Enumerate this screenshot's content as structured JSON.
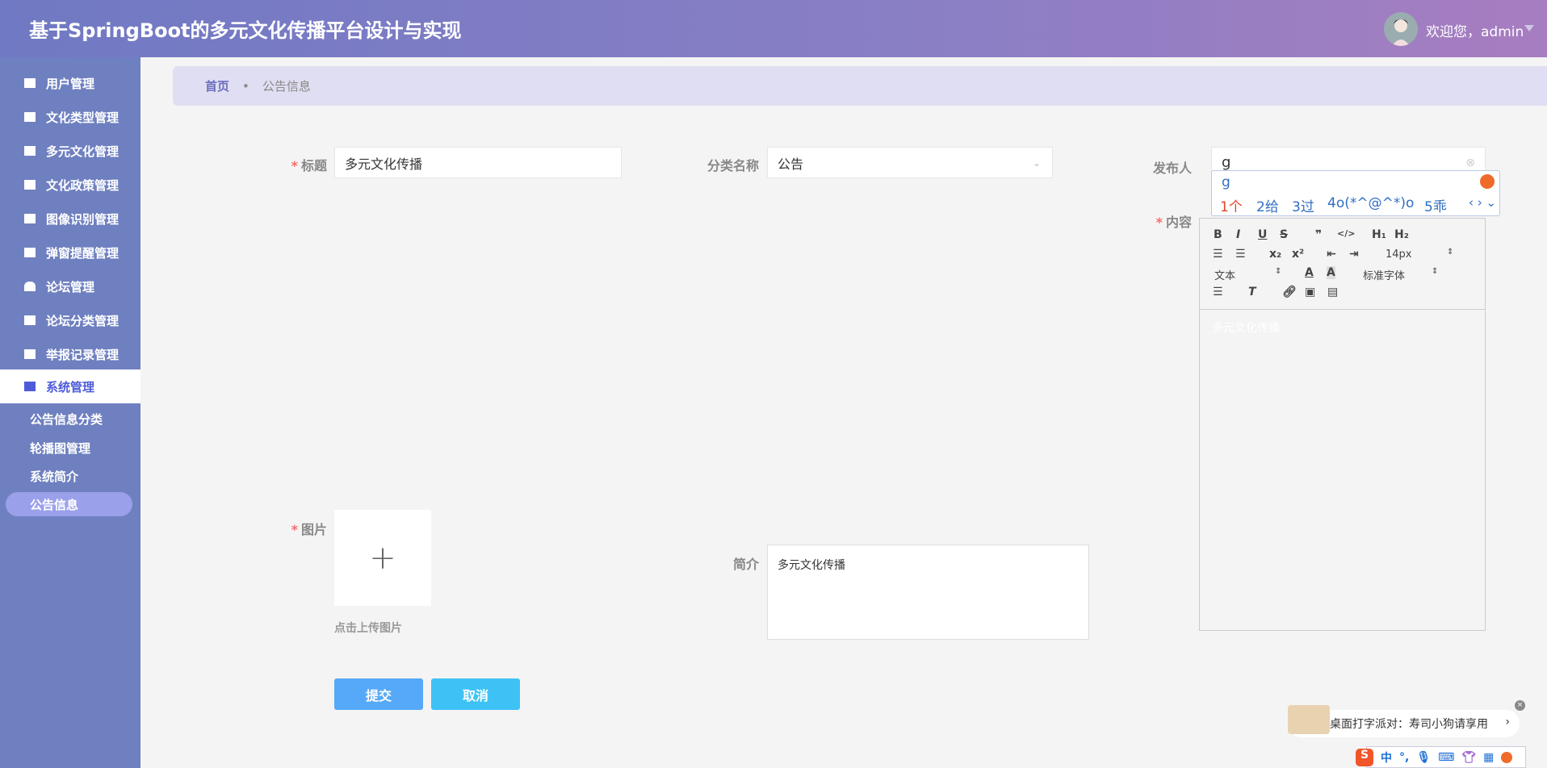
{
  "header": {
    "title": "基于SpringBoot的多元文化传播平台设计与实现",
    "welcome": "欢迎您，admin"
  },
  "sidebar": {
    "items": [
      {
        "label": "用户管理",
        "icon": "list-icon"
      },
      {
        "label": "文化类型管理",
        "icon": "grid-icon"
      },
      {
        "label": "多元文化管理",
        "icon": "chart-icon"
      },
      {
        "label": "文化政策管理",
        "icon": "clipboard-icon"
      },
      {
        "label": "图像识别管理",
        "icon": "apps-icon"
      },
      {
        "label": "弹窗提醒管理",
        "icon": "book-icon"
      },
      {
        "label": "论坛管理",
        "icon": "user-icon"
      },
      {
        "label": "论坛分类管理",
        "icon": "apps-icon"
      },
      {
        "label": "举报记录管理",
        "icon": "apps-icon"
      },
      {
        "label": "系统管理",
        "icon": "briefcase-icon",
        "active": true
      }
    ],
    "sub_items": [
      {
        "label": "公告信息分类"
      },
      {
        "label": "轮播图管理"
      },
      {
        "label": "系统简介"
      },
      {
        "label": "公告信息",
        "active": true
      }
    ]
  },
  "breadcrumb": {
    "home": "首页",
    "separator": "•",
    "current": "公告信息"
  },
  "form": {
    "title_label": "标题",
    "title_value": "多元文化传播",
    "category_label": "分类名称",
    "category_value": "公告",
    "publisher_label": "发布人",
    "publisher_value": "g",
    "content_label": "内容",
    "content_value": "多元文化传播",
    "image_label": "图片",
    "upload_hint": "点击上传图片",
    "upload_plus": "+",
    "intro_label": "简介",
    "intro_value": "多元文化传播",
    "submit": "提交",
    "cancel": "取消"
  },
  "editor": {
    "font_size": "14px",
    "header_select": "文本",
    "font_family": "标准字体"
  },
  "ime": {
    "input": "g",
    "candidates": [
      "1个",
      "2给",
      "3过",
      "4o(*^@^*)o",
      "5乖"
    ]
  },
  "ad": {
    "text": "桌面打字派对：寿司小狗请享用"
  },
  "ime_bar": {
    "lang": "中",
    "punct": "°,"
  },
  "colors": {
    "header_start": "#7079c3",
    "header_end": "#a77dc0",
    "sidebar": "#6f80c0",
    "submit": "#56a9f8",
    "cancel": "#3ec2f6",
    "required": "#f56c6c"
  }
}
